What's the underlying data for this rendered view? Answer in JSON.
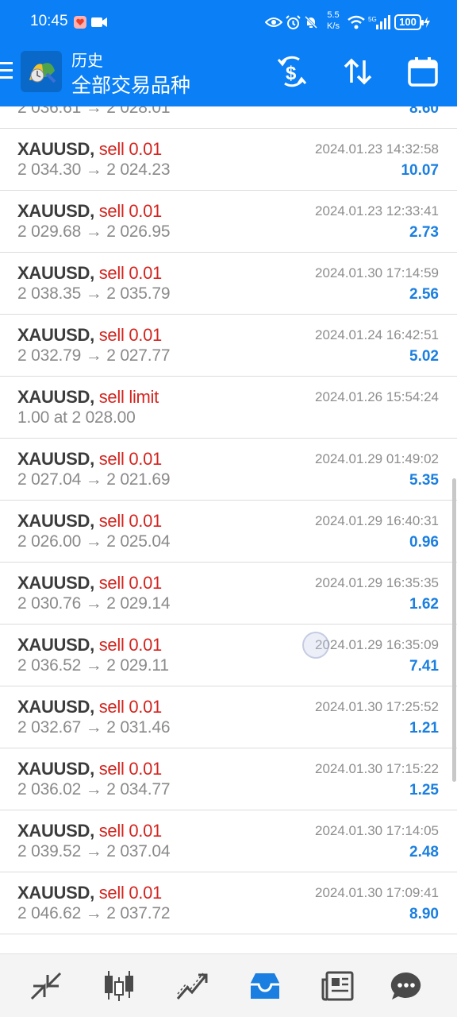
{
  "status_bar": {
    "time": "10:45",
    "net_speed_value": "5.5",
    "net_speed_unit": "K/s",
    "battery": "100"
  },
  "app_bar": {
    "title_small": "历史",
    "title_big": "全部交易品种"
  },
  "partial_top_row": {
    "prices": "2 036.61 → 2 028.01",
    "profit": "8.60"
  },
  "trades": [
    {
      "symbol": "XAUUSD,",
      "side": "sell 0.01",
      "prices": "2 034.30 → 2 024.23",
      "datetime": "2024.01.23 14:32:58",
      "profit": "10.07"
    },
    {
      "symbol": "XAUUSD,",
      "side": "sell 0.01",
      "prices": "2 029.68 → 2 026.95",
      "datetime": "2024.01.23 12:33:41",
      "profit": "2.73"
    },
    {
      "symbol": "XAUUSD,",
      "side": "sell 0.01",
      "prices": "2 038.35 → 2 035.79",
      "datetime": "2024.01.30 17:14:59",
      "profit": "2.56"
    },
    {
      "symbol": "XAUUSD,",
      "side": "sell 0.01",
      "prices": "2 032.79 → 2 027.77",
      "datetime": "2024.01.24 16:42:51",
      "profit": "5.02"
    },
    {
      "symbol": "XAUUSD,",
      "side": "sell limit",
      "prices": "1.00 at 2 028.00",
      "datetime": "2024.01.26 15:54:24",
      "profit": ""
    },
    {
      "symbol": "XAUUSD,",
      "side": "sell 0.01",
      "prices": "2 027.04 → 2 021.69",
      "datetime": "2024.01.29 01:49:02",
      "profit": "5.35"
    },
    {
      "symbol": "XAUUSD,",
      "side": "sell 0.01",
      "prices": "2 026.00 → 2 025.04",
      "datetime": "2024.01.29 16:40:31",
      "profit": "0.96"
    },
    {
      "symbol": "XAUUSD,",
      "side": "sell 0.01",
      "prices": "2 030.76 → 2 029.14",
      "datetime": "2024.01.29 16:35:35",
      "profit": "1.62"
    },
    {
      "symbol": "XAUUSD,",
      "side": "sell 0.01",
      "prices": "2 036.52 → 2 029.11",
      "datetime": "2024.01.29 16:35:09",
      "profit": "7.41"
    },
    {
      "symbol": "XAUUSD,",
      "side": "sell 0.01",
      "prices": "2 032.67 → 2 031.46",
      "datetime": "2024.01.30 17:25:52",
      "profit": "1.21"
    },
    {
      "symbol": "XAUUSD,",
      "side": "sell 0.01",
      "prices": "2 036.02 → 2 034.77",
      "datetime": "2024.01.30 17:15:22",
      "profit": "1.25"
    },
    {
      "symbol": "XAUUSD,",
      "side": "sell 0.01",
      "prices": "2 039.52 → 2 037.04",
      "datetime": "2024.01.30 17:14:05",
      "profit": "2.48"
    },
    {
      "symbol": "XAUUSD,",
      "side": "sell 0.01",
      "prices": "2 046.62 → 2 037.72",
      "datetime": "2024.01.30 17:09:41",
      "profit": "8.90"
    }
  ],
  "bottom_nav": [
    {
      "name": "quotes",
      "icon": "quotes-arrows-icon",
      "active": false
    },
    {
      "name": "chart",
      "icon": "candlestick-icon",
      "active": false
    },
    {
      "name": "trade",
      "icon": "trend-line-icon",
      "active": false
    },
    {
      "name": "history",
      "icon": "inbox-tray-icon",
      "active": true
    },
    {
      "name": "news",
      "icon": "newspaper-icon",
      "active": false
    },
    {
      "name": "chat",
      "icon": "chat-bubble-icon",
      "active": false
    }
  ],
  "colors": {
    "header_blue": "#0a7ff6",
    "sell_red": "#d4251f",
    "profit_blue": "#1a7fe0",
    "nav_active": "#1a7fe0",
    "nav_inactive": "#4a4a4a"
  }
}
